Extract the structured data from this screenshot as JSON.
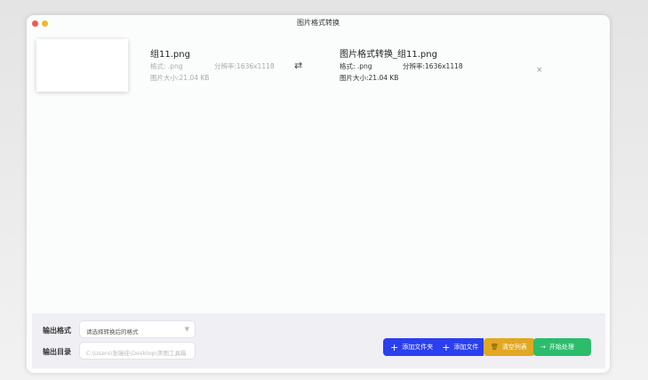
{
  "window": {
    "title": "图片格式转换"
  },
  "source": {
    "name": "组11.png",
    "format": "格式: .png",
    "resolution": "分辨率:1636x1118",
    "size": "图片大小:21.04 KB"
  },
  "target": {
    "name": "图片格式转换_组11.png",
    "format": "格式: .png",
    "resolution": "分辨率:1636x1118",
    "size": "图片大小:21.04 KB"
  },
  "output": {
    "format_label": "输出格式",
    "format_placeholder": "请选择转换后的格式",
    "dir_label": "输出目录",
    "dir_value": "C:\\Users\\张瑞佳\\Desktop\\美图工具箱"
  },
  "buttons": {
    "add_folder": "添加文件夹",
    "add_file": "添加文件",
    "clear": "清空列表",
    "start": "开始处理"
  },
  "colors": {
    "blue": "#2b3ff0",
    "yellow": "#e0a823",
    "green": "#2cbc6c"
  }
}
